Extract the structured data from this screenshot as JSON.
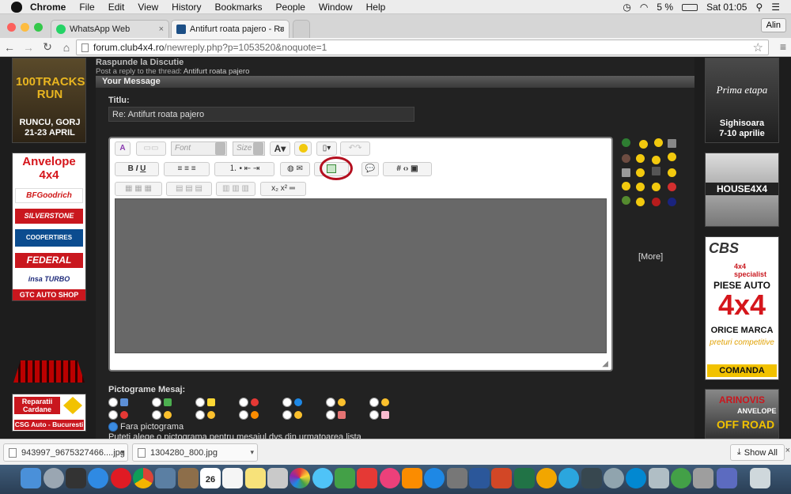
{
  "menubar": {
    "app_name": "Chrome",
    "items": [
      "File",
      "Edit",
      "View",
      "History",
      "Bookmarks",
      "People",
      "Window",
      "Help"
    ],
    "battery": "5 %",
    "clock": "Sat 01:05"
  },
  "tabs": [
    {
      "label": "WhatsApp Web",
      "favicon_color": "#25d366"
    },
    {
      "label": "Antifurt roata pajero - Rasp",
      "favicon_color": "#1c4f86"
    }
  ],
  "profile_name": "Alin",
  "address": {
    "domain": "forum.club4x4.ro",
    "path": "/newreply.php?p=1053520&noquote=1"
  },
  "page": {
    "breadcrumb_title": "Raspunde la Discutie",
    "breadcrumb_prefix": "Post a reply to the thread:",
    "breadcrumb_thread": "Antifurt roata pajero",
    "section_header": "Your Message",
    "title_label": "Titlu:",
    "title_value": "Re: Antifurt roata pajero",
    "font_placeholder": "Font",
    "size_placeholder": "Size",
    "more_link": "[More]",
    "pictograms_label": "Pictograme Mesaj:",
    "no_icon_label": "Fara pictograma",
    "pictogram_hint": "Puteti alege o pictograma pentru mesajul dvs din urmatoarea lista"
  },
  "ads": {
    "left_top": {
      "title": "100TRACKS RUN",
      "place": "RUNCU, GORJ",
      "date": "21-23 APRIL"
    },
    "left_tires": {
      "title": "Anvelope 4x4",
      "brands": [
        "BFGoodrich",
        "SILVERSTONE",
        "COOPERTIRES",
        "FEDERAL",
        "insa TURBO"
      ],
      "shop": "GTC AUTO SHOP"
    },
    "left_cardan": {
      "line1": "Reparatii",
      "line2": "Cardane",
      "line3": "CSG Auto - Bucuresti"
    },
    "right_top": {
      "title": "Prima etapa",
      "place": "Sighisoara",
      "date": "7-10 aprilie"
    },
    "right_house": {
      "title": "HOUSE4X4"
    },
    "right_cbs": {
      "brand": "CBS",
      "tag": "4x4 specialist",
      "line1": "PIESE AUTO",
      "line2": "4x4",
      "line3": "ORICE MARCA",
      "line4": "preturi competitive",
      "cta": "COMANDA"
    },
    "right_bottom": {
      "title": "ARINOVIS",
      "sub": "ANVELOPE",
      "road": "OFF ROAD"
    }
  },
  "downloads": [
    {
      "name": "943997_9675327466....jpg"
    },
    {
      "name": "1304280_800.jpg"
    }
  ],
  "show_all_label": "Show All",
  "dock_date": "26"
}
